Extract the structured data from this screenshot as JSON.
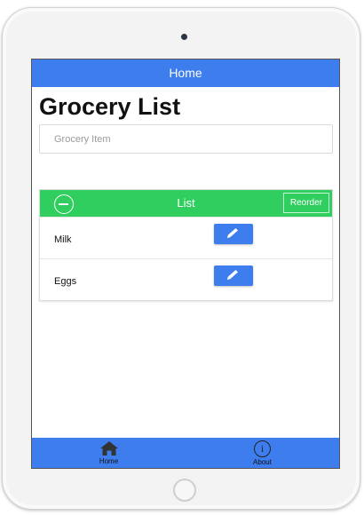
{
  "header": {
    "title": "Home"
  },
  "page": {
    "title": "Grocery List"
  },
  "input": {
    "placeholder": "Grocery Item",
    "value": ""
  },
  "list": {
    "title": "List",
    "reorder_label": "Reorder",
    "items": [
      {
        "label": "Milk"
      },
      {
        "label": "Eggs"
      }
    ]
  },
  "tabs": [
    {
      "label": "Home",
      "icon": "home-icon"
    },
    {
      "label": "About",
      "icon": "info-icon"
    }
  ],
  "colors": {
    "primary": "#3d7ded",
    "list_header": "#2fce5f"
  }
}
